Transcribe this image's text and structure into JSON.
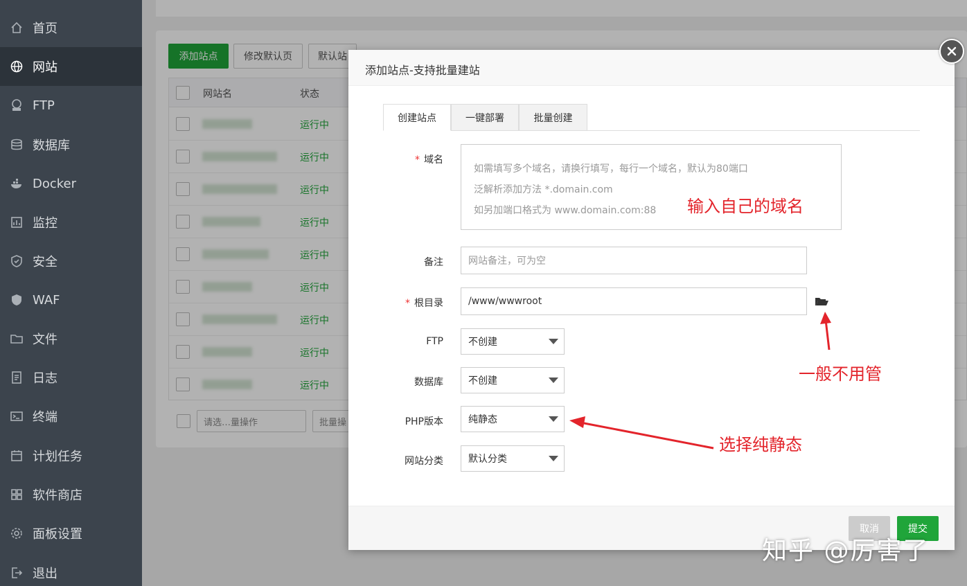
{
  "sidebar": {
    "items": [
      {
        "label": "首页",
        "icon": "home-icon"
      },
      {
        "label": "网站",
        "icon": "globe-icon"
      },
      {
        "label": "FTP",
        "icon": "ftp-icon"
      },
      {
        "label": "数据库",
        "icon": "database-icon"
      },
      {
        "label": "Docker",
        "icon": "docker-icon"
      },
      {
        "label": "监控",
        "icon": "monitor-icon"
      },
      {
        "label": "安全",
        "icon": "shield-icon"
      },
      {
        "label": "WAF",
        "icon": "waf-icon"
      },
      {
        "label": "文件",
        "icon": "folder-icon"
      },
      {
        "label": "日志",
        "icon": "log-icon"
      },
      {
        "label": "终端",
        "icon": "terminal-icon"
      },
      {
        "label": "计划任务",
        "icon": "calendar-icon"
      },
      {
        "label": "软件商店",
        "icon": "apps-icon"
      },
      {
        "label": "面板设置",
        "icon": "gear-icon"
      },
      {
        "label": "退出",
        "icon": "logout-icon"
      }
    ]
  },
  "background": {
    "toolbar": {
      "add_site": "添加站点",
      "edit_default": "修改默认页",
      "default_site": "默认站"
    },
    "table": {
      "col_name": "网站名",
      "col_status": "状态",
      "rows": [
        {
          "status": "运行中"
        },
        {
          "status": "运行中"
        },
        {
          "status": "运行中"
        },
        {
          "status": "运行中"
        },
        {
          "status": "运行中"
        },
        {
          "status": "运行中"
        },
        {
          "status": "运行中"
        },
        {
          "status": "运行中"
        },
        {
          "status": "运行中"
        }
      ]
    },
    "batch_select": "请选…量操作",
    "batch_btn": "批量操"
  },
  "modal": {
    "title": "添加站点-支持批量建站",
    "tabs": [
      "创建站点",
      "一键部署",
      "批量创建"
    ],
    "domain": {
      "label": "域名",
      "placeholder_lines": [
        "如需填写多个域名，请换行填写，每行一个域名，默认为80端口",
        "泛解析添加方法 *.domain.com",
        "如另加端口格式为 www.domain.com:88"
      ]
    },
    "remark": {
      "label": "备注",
      "placeholder": "网站备注，可为空"
    },
    "root": {
      "label": "根目录",
      "value": "/www/wwwroot"
    },
    "ftp": {
      "label": "FTP",
      "value": "不创建"
    },
    "database": {
      "label": "数据库",
      "value": "不创建"
    },
    "php": {
      "label": "PHP版本",
      "value": "纯静态"
    },
    "category": {
      "label": "网站分类",
      "value": "默认分类"
    },
    "cancel": "取消",
    "submit": "提交"
  },
  "annotations": {
    "domain_note": "输入自己的域名",
    "root_note": "一般不用管",
    "php_note": "选择纯静态"
  },
  "watermark": "知乎 @厉害了",
  "colors": {
    "accent": "#20a53a",
    "annotation": "#e3242b",
    "sidebar": "#3c444d"
  }
}
